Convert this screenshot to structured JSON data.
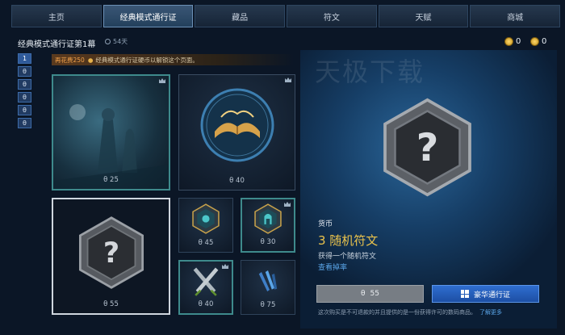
{
  "nav": {
    "tabs": [
      {
        "label": "主页"
      },
      {
        "label": "经典模式通行证"
      },
      {
        "label": "藏品"
      },
      {
        "label": "符文"
      },
      {
        "label": "天赋"
      },
      {
        "label": "商城"
      }
    ],
    "active_index": 1
  },
  "header": {
    "pass_title": "经典模式通行证第1幕",
    "days_left": "54天"
  },
  "currency": {
    "coin_a": "0",
    "coin_b": "0"
  },
  "notice": {
    "amount": "再花费250",
    "text": "经典模式通行证硬币以解锁这个页面。"
  },
  "pages": [
    "1",
    "",
    "",
    "",
    "",
    ""
  ],
  "cards": [
    {
      "price": "25"
    },
    {
      "price": "40"
    },
    {
      "price": "55"
    },
    {
      "price": "45"
    },
    {
      "price": "30"
    },
    {
      "price": "40"
    },
    {
      "price": "75"
    }
  ],
  "detail": {
    "watermark": "天极下载",
    "category": "货币",
    "name": "3 随机符文",
    "description": "获得一个随机符文",
    "link": "查看掉率",
    "buy_price": "55",
    "deluxe_label": "豪华通行证",
    "disclaimer": "这次购买是不可退款的并且提供的是一份获得许可的数码商品。",
    "learn_more": "了解更多"
  },
  "colors": {
    "accent_gold": "#e9c24c",
    "link_blue": "#5aa5e8",
    "deluxe_blue": "#2f6ed0"
  }
}
